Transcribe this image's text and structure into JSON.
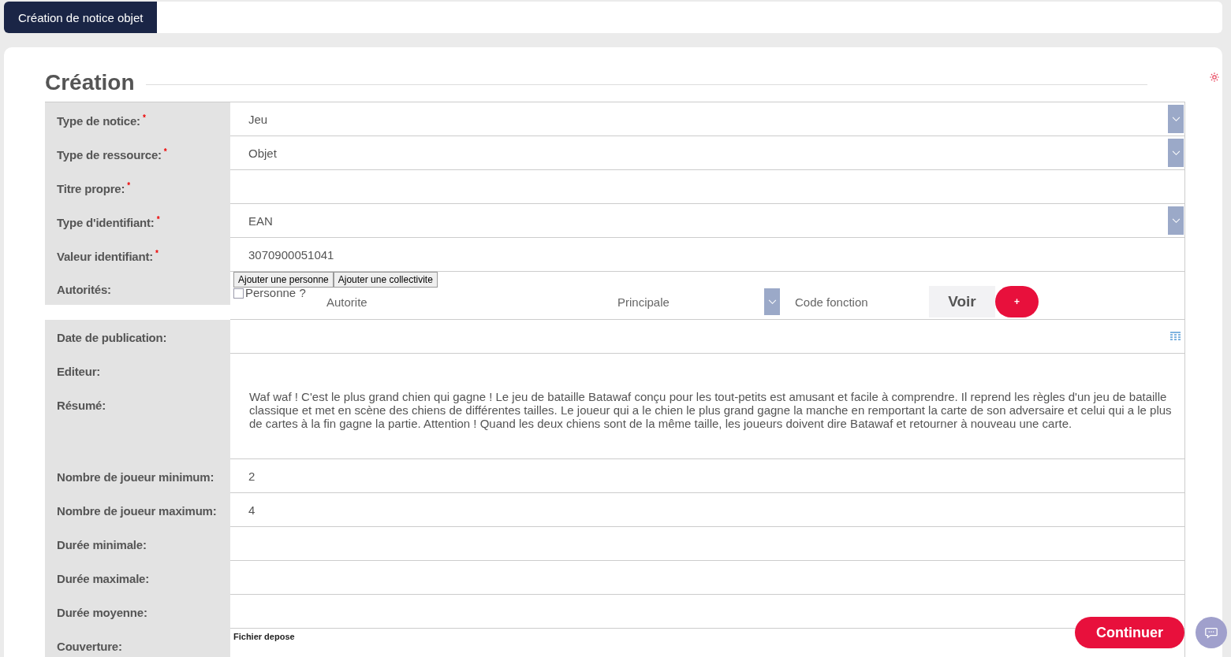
{
  "tab": {
    "label": "Création de notice objet",
    "selected": true
  },
  "section_title": "Création",
  "rows": [
    {
      "kind": "select",
      "label": "Type de notice:",
      "mark": "*",
      "value": "Jeu"
    },
    {
      "kind": "select",
      "label": "Type de ressource:",
      "mark": "*",
      "value": "Objet"
    },
    {
      "kind": "text",
      "label": "Titre propre:",
      "mark": "*"
    },
    {
      "kind": "select",
      "label": "Type d'identifiant:",
      "mark": "*",
      "value": "EAN"
    },
    {
      "kind": "text",
      "label": "Valeur identifiant:",
      "mark": "*",
      "value": "3070900051041"
    },
    {
      "kind": "authorities",
      "label": "Autorités:",
      "buttons": [
        "Ajouter une personne",
        "Ajouter une collectivite"
      ],
      "checkbox": {
        "label": "Personne ?",
        "checked": false
      },
      "authority_placeholder": "Autorite",
      "principal_placeholder": "Principale",
      "code_placeholder": "Code fonction",
      "view_button": "Voir",
      "add_button": "+"
    },
    {
      "kind": "date",
      "label": "Date de publication:"
    },
    {
      "kind": "text",
      "label": "Editeur:"
    },
    {
      "kind": "textarea",
      "label": "Résumé:",
      "value": "Waf waf ! C'est le plus grand chien qui gagne ! Le jeu de bataille Batawaf conçu pour les tout-petits est amusant et facile à comprendre. Il reprend les règles d'un jeu de bataille classique et met en scène des chiens de différentes tailles. Le joueur qui a le chien le plus grand gagne la manche en remportant la carte de son adversaire et celui qui a le plus de cartes à la fin gagne la partie. Attention ! Quand les deux chiens sont de la même taille, les joueurs doivent dire Batawaf et retourner à nouveau une carte."
    },
    {
      "kind": "text",
      "label": "Nombre de joueur minimum:",
      "value": "2"
    },
    {
      "kind": "text",
      "label": "Nombre de joueur maximum:",
      "value": "4"
    },
    {
      "kind": "text",
      "label": "Durée minimale:"
    },
    {
      "kind": "text",
      "label": "Durée maximale:"
    },
    {
      "kind": "text",
      "label": "Durée moyenne:"
    },
    {
      "kind": "file",
      "label": "Couverture:",
      "note": "Fichier depose"
    }
  ],
  "continue_button": "Continuer"
}
